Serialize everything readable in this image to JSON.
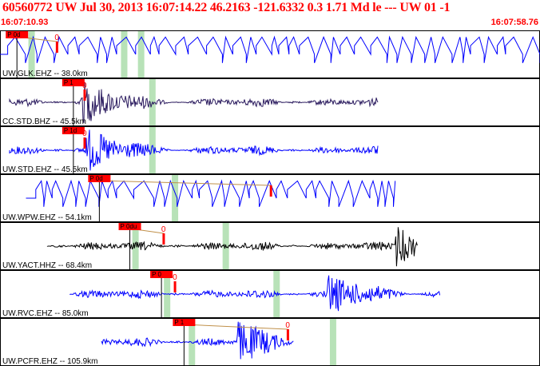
{
  "header": {
    "title": "60560772 UW Jul 30, 2013 16:07:14.22   46.2163 -121.6332  0.3 1.71 Md le --- UW 01  -1",
    "time_start": "16:07:10.93",
    "time_end": "16:07:58.76"
  },
  "colors": {
    "header_text": "#ff0000",
    "trace_blue": "#0000ff",
    "trace_purple": "#2a1a5e",
    "trace_black": "#000000",
    "pick_red": "#ff0000",
    "window_green": "#b8e2b8",
    "coda_brown": "#c0904a"
  },
  "traces": [
    {
      "label": "UW.GLK.EHZ -- 38.0km",
      "pick_label": "P 0d",
      "end_label": "0",
      "color": "#0000ff",
      "style": "clipped",
      "amplitude": 0.25,
      "pick_time": 1.5,
      "end_time": 5.05,
      "data_start": 0.0,
      "data_end": 48,
      "burst_time": null,
      "green_windows": [
        2.8,
        11.0,
        12.5
      ]
    },
    {
      "label": "CC.STD.BHZ -- 45.5km",
      "pick_label": "P 1",
      "end_label": "0",
      "color": "#2a1a5e",
      "style": "noise",
      "amplitude": 0.25,
      "pick_time": 6.5,
      "end_time": 7.5,
      "data_start": 0.85,
      "data_end": 33.5,
      "burst_time": 7.2,
      "green_windows": [
        13.5
      ]
    },
    {
      "label": "UW.STD.EHZ -- 45.5km",
      "pick_label": "P 1d",
      "end_label": "0",
      "color": "#0000ff",
      "style": "noise",
      "amplitude": 0.25,
      "pick_time": 6.5,
      "end_time": 7.5,
      "data_start": 0.85,
      "data_end": 33.5,
      "burst_time": 7.6,
      "green_windows": [
        13.5
      ]
    },
    {
      "label": "UW.WPW.EHZ -- 54.1km",
      "pick_label": "P 0d",
      "end_label": "",
      "color": "#0000ff",
      "style": "clipped",
      "amplitude": 0.25,
      "pick_time": 8.8,
      "end_time": 24.0,
      "data_start": 2.3,
      "data_end": 35.0,
      "burst_time": null,
      "green_windows": [
        15.5
      ]
    },
    {
      "label": "UW.YACT.HHZ -- 68.4km",
      "pick_label": "P 0du",
      "end_label": "0",
      "color": "#000000",
      "style": "noise",
      "amplitude": 0.25,
      "pick_time": 11.5,
      "end_time": 14.5,
      "data_start": 4.2,
      "data_end": 37.0,
      "burst_time": 35.0,
      "green_windows": [
        12.0,
        20.0
      ]
    },
    {
      "label": "UW.RVC.EHZ -- 85.0km",
      "pick_label": "P 0",
      "end_label": "0",
      "color": "#0000ff",
      "style": "noise",
      "amplitude": 0.25,
      "pick_time": 14.3,
      "end_time": 15.5,
      "data_start": 6.2,
      "data_end": 39.0,
      "burst_time": 29.0,
      "green_windows": [
        14.8,
        24.5
      ]
    },
    {
      "label": "UW.PCFR.EHZ -- 105.9km",
      "pick_label": "P 1",
      "end_label": "0",
      "color": "#0000ff",
      "style": "noise",
      "amplitude": 0.25,
      "pick_time": 16.3,
      "end_time": 25.5,
      "data_start": 9.0,
      "data_end": 26.0,
      "burst_time": 21.0,
      "green_windows": [
        17.0,
        29.5
      ]
    }
  ]
}
